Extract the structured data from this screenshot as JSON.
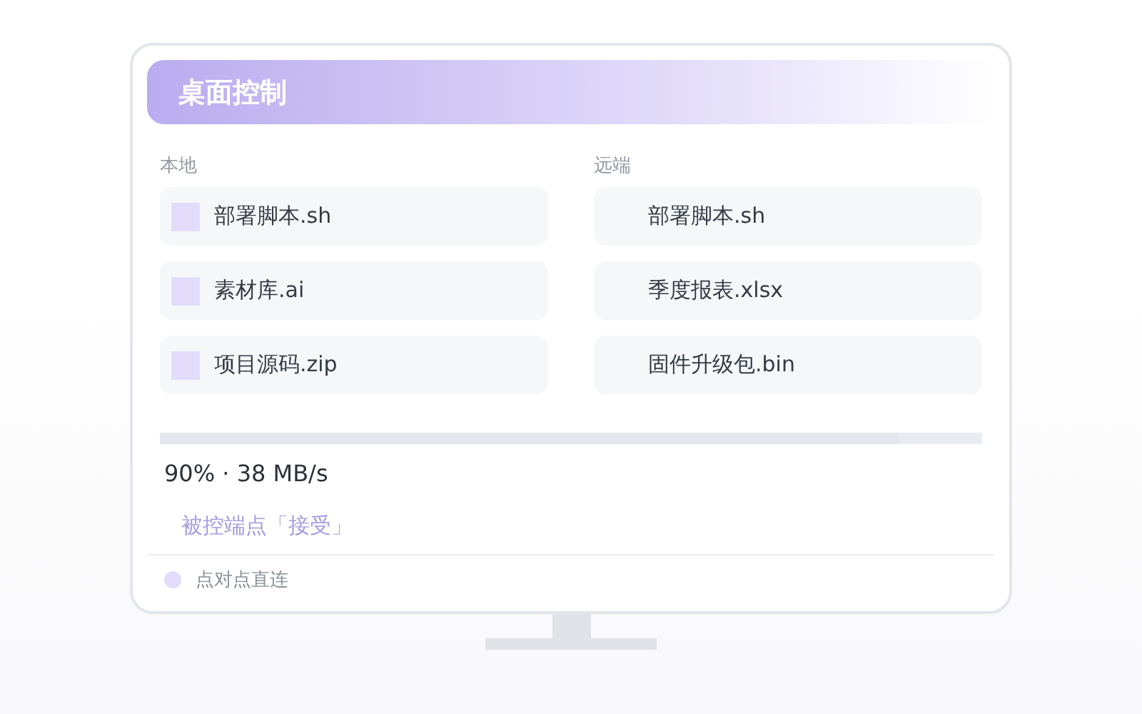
{
  "header": {
    "title": "桌面控制"
  },
  "panes": [
    {
      "label": "本地",
      "kind": "local",
      "files": [
        {
          "name": "部署脚本.sh"
        },
        {
          "name": "素材库.ai"
        },
        {
          "name": "项目源码.zip"
        }
      ]
    },
    {
      "label": "远端",
      "kind": "remote",
      "files": [
        {
          "name": "部署脚本.sh"
        },
        {
          "name": "季度报表.xlsx"
        },
        {
          "name": "固件升级包.bin"
        }
      ]
    }
  ],
  "transfer": {
    "level": 0.9,
    "reading": "90% · 38 MB/s"
  },
  "prompt": "被控端点「接受」",
  "footer": {
    "status": "点对点直连"
  }
}
